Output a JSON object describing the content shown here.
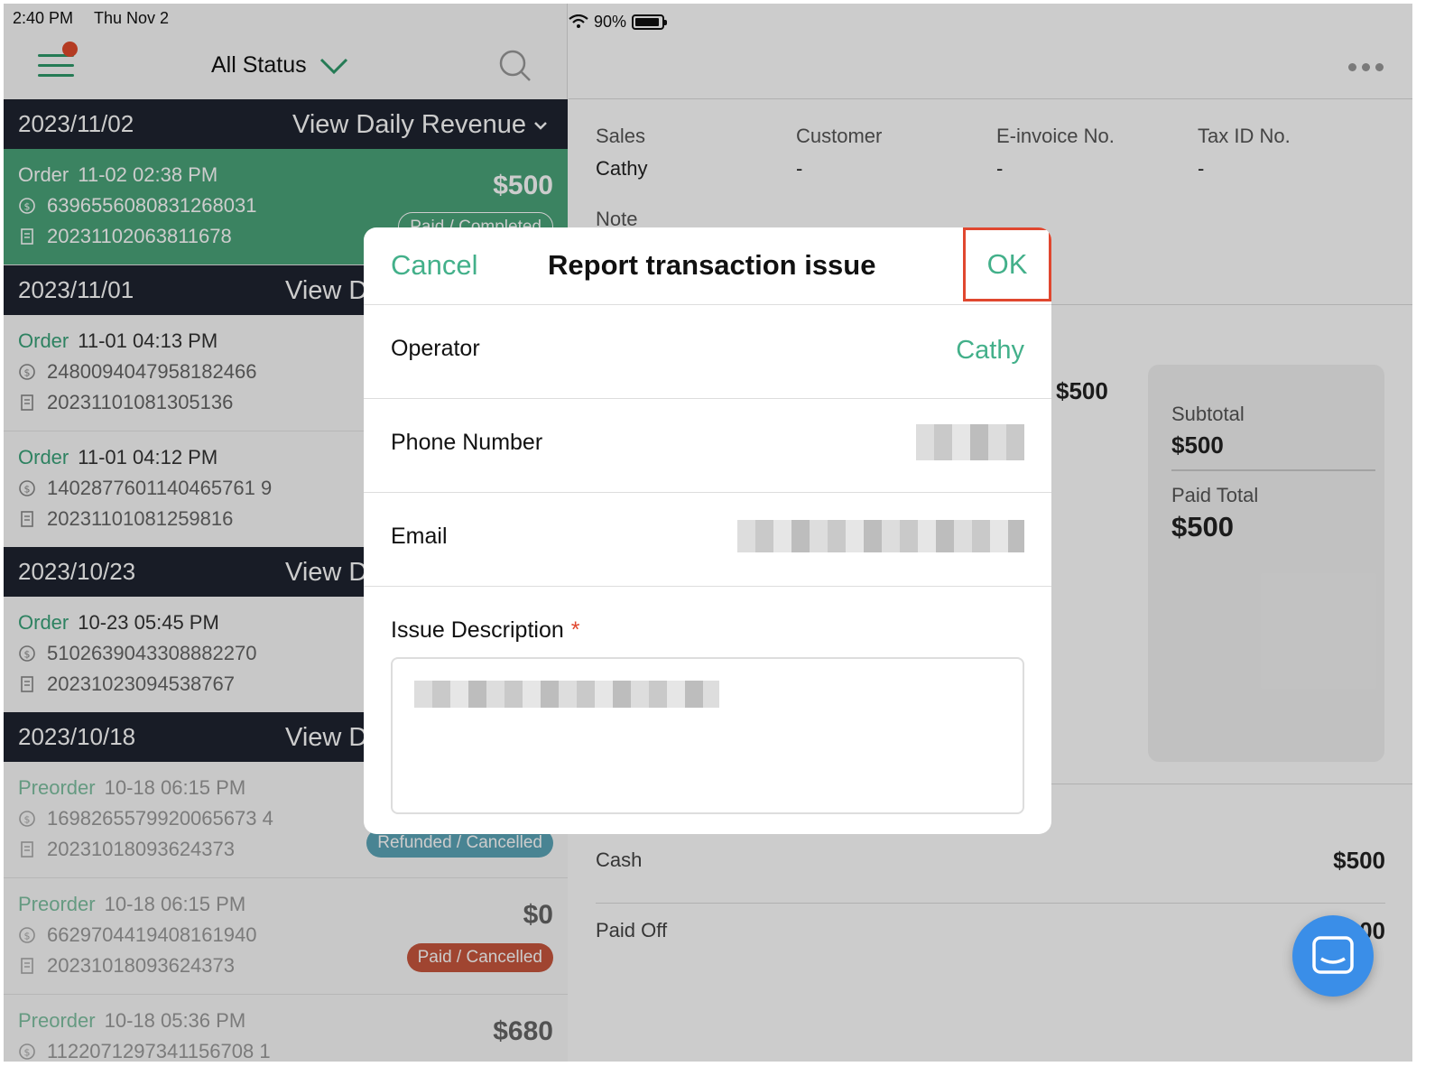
{
  "status_bar": {
    "time": "2:40 PM",
    "date": "Thu Nov 2",
    "battery": "90%"
  },
  "left_header": {
    "filter_label": "All Status"
  },
  "groups": [
    {
      "date": "2023/11/02",
      "view_label": "View Daily Revenue"
    },
    {
      "date": "2023/11/01",
      "view_label": "View D"
    },
    {
      "date": "2023/10/23",
      "view_label": "View D"
    },
    {
      "date": "2023/10/18",
      "view_label": "View D"
    }
  ],
  "orders": [
    {
      "kind": "Order",
      "time": "11-02 02:38 PM",
      "number": "6396556080831268031",
      "invoice": "20231102063811678",
      "amount": "$500",
      "badge": "Paid / Completed"
    },
    {
      "kind": "Order",
      "time": "11-01 04:13 PM",
      "number": "2480094047958182466",
      "invoice": "20231101081305136",
      "amount": "",
      "badge": ""
    },
    {
      "kind": "Order",
      "time": "11-01 04:12 PM",
      "number": "1402877601140465761 9",
      "invoice": "20231101081259816",
      "amount": "",
      "badge": ""
    },
    {
      "kind": "Order",
      "time": "10-23 05:45 PM",
      "number": "5102639043308882270",
      "invoice": "20231023094538767",
      "amount": "",
      "badge": ""
    },
    {
      "kind": "Preorder",
      "time": "10-18 06:15 PM",
      "number": "1698265579920065673 4",
      "invoice": "20231018093624373",
      "amount": "",
      "badge": "Refunded / Cancelled"
    },
    {
      "kind": "Preorder",
      "time": "10-18 06:15 PM",
      "number": "6629704419408161940",
      "invoice": "20231018093624373",
      "amount": "$0",
      "badge": "Paid / Cancelled"
    },
    {
      "kind": "Preorder",
      "time": "10-18 05:36 PM",
      "number": "1122071297341156708 1",
      "invoice": "",
      "amount": "$680",
      "badge": ""
    }
  ],
  "detail": {
    "sales_label": "Sales",
    "sales_value": "Cathy",
    "customer_label": "Customer",
    "customer_value": "-",
    "einvoice_label": "E-invoice No.",
    "einvoice_value": "-",
    "taxid_label": "Tax ID No.",
    "taxid_value": "-",
    "note_label": "Note",
    "item_price": "$500",
    "subtotal_label": "Subtotal",
    "subtotal_value": "$500",
    "paid_total_label": "Paid Total",
    "paid_total_value": "$500",
    "cash_label": "Cash",
    "cash_value": "$500",
    "paid_off_label": "Paid Off",
    "paid_off_value": "00"
  },
  "modal": {
    "cancel_label": "Cancel",
    "title": "Report transaction issue",
    "ok_label": "OK",
    "operator_label": "Operator",
    "operator_value": "Cathy",
    "phone_label": "Phone Number",
    "email_label": "Email",
    "desc_label": "Issue Description",
    "required_mark": "*"
  },
  "colors": {
    "accent": "#43b08a",
    "dark_header": "#1e2430",
    "selected_row": "#4aa47a",
    "highlight": "#e0472f",
    "badge_red": "#c9573e",
    "badge_teal": "#5ca5b8",
    "chat": "#3a8ee8"
  }
}
